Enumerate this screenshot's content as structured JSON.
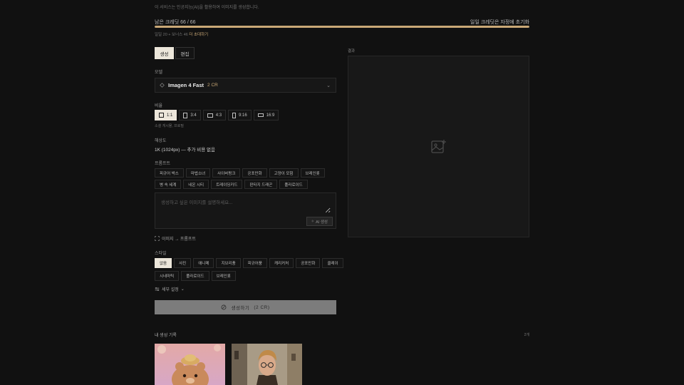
{
  "notice": "이 서비스는 인공지능(AI)을 활용하여 이미지를 생성합니다.",
  "credits": {
    "label": "남은 크레딧 66 / 66",
    "reset_text": "일일 크레딧은 자정에 초기화",
    "remaining_fraction": 1.0,
    "bonus_text": "일일 20 + 보너스 46",
    "invite_link": "더 초대하기"
  },
  "tabs": [
    {
      "label": "생성",
      "active": true
    },
    {
      "label": "편집",
      "active": false
    }
  ],
  "model": {
    "label": "모델",
    "name": "Imagen 4 Fast",
    "cost": "2 CR"
  },
  "ratio": {
    "label": "비율",
    "options": [
      {
        "label": "1:1",
        "active": true
      },
      {
        "label": "3:4",
        "active": false
      },
      {
        "label": "4:3",
        "active": false
      },
      {
        "label": "9:16",
        "active": false
      },
      {
        "label": "16:9",
        "active": false
      }
    ],
    "hint": "소셜 게시물, 프로필"
  },
  "resolution": {
    "label": "해상도",
    "value": "1K (1024px) — 추가 비용 없음"
  },
  "prompt": {
    "label": "프롬프트",
    "presets_row1": [
      "피규어 박스",
      "마법소녀",
      "사이버펑크",
      "공포만화",
      "고양이 모험",
      "브레인롯"
    ],
    "presets_row2": [
      "병 속 세계",
      "네온 시티",
      "트레이딩카드",
      "판타지 드래곤",
      "폴라로이드"
    ],
    "placeholder": "생성하고 싶은 이미지를 설명하세요...",
    "ai_button": "AI 생성"
  },
  "image_to_prompt": "이미지 → 프롬프트",
  "style": {
    "label": "스타일",
    "row1": [
      {
        "label": "없음",
        "active": true
      },
      {
        "label": "사진",
        "active": false
      },
      {
        "label": "애니메",
        "active": false
      },
      {
        "label": "지브리풍",
        "active": false
      },
      {
        "label": "피규어풍",
        "active": false
      },
      {
        "label": "캐리커처",
        "active": false
      },
      {
        "label": "공포만화",
        "active": false
      },
      {
        "label": "클레이",
        "active": false
      }
    ],
    "row2": [
      {
        "label": "시네마틱",
        "active": false
      },
      {
        "label": "폴라로이드",
        "active": false
      },
      {
        "label": "브레인롯",
        "active": false
      }
    ]
  },
  "detail_settings": "세부 설정",
  "generate_button": {
    "label": "생성하기",
    "cost": "(2 CR)"
  },
  "result": {
    "label": "결과"
  },
  "history": {
    "label": "내 생성 기록",
    "count": "2개"
  },
  "colors": {
    "accent": "#c9a876",
    "background": "#111111",
    "active_chip": "#ece6da"
  }
}
